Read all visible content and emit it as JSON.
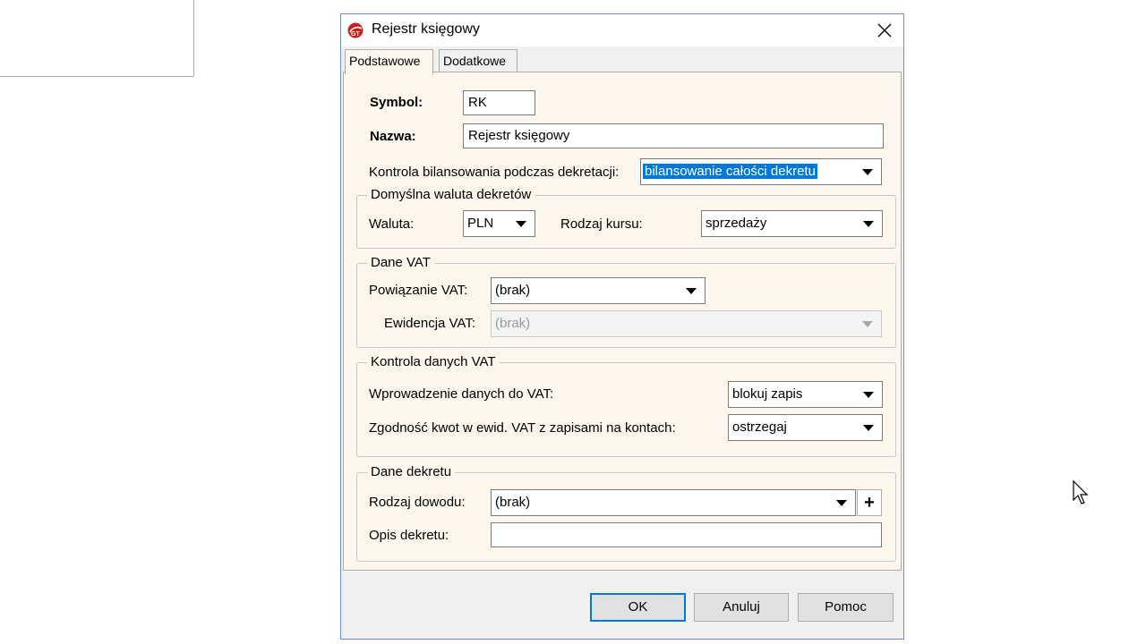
{
  "dialog": {
    "title": "Rejestr księgowy",
    "close_icon": "close-icon",
    "app_icon": "gt-logo-icon"
  },
  "tabs": [
    {
      "label": "Podstawowe",
      "active": true
    },
    {
      "label": "Dodatkowe",
      "active": false
    }
  ],
  "form": {
    "symbol_label": "Symbol:",
    "symbol_value": "RK",
    "name_label": "Nazwa:",
    "name_value": "Rejestr księgowy",
    "balance_label": "Kontrola bilansowania podczas dekretacji:",
    "balance_value": "bilansowanie całości dekretu"
  },
  "currency_group": {
    "legend": "Domyślna waluta dekretów",
    "currency_label": "Waluta:",
    "currency_value": "PLN",
    "rate_label": "Rodzaj kursu:",
    "rate_value": "sprzedaży"
  },
  "vat_group": {
    "legend": "Dane VAT",
    "link_label": "Powiązanie VAT:",
    "link_value": "(brak)",
    "register_label": "Ewidencja VAT:",
    "register_value": "(brak)"
  },
  "vat_control_group": {
    "legend": "Kontrola danych VAT",
    "entry_label": "Wprowadzenie danych do VAT:",
    "entry_value": "blokuj zapis",
    "match_label": "Zgodność kwot w ewid. VAT z zapisami na kontach:",
    "match_value": "ostrzegaj"
  },
  "decree_group": {
    "legend": "Dane dekretu",
    "doc_type_label": "Rodzaj dowodu:",
    "doc_type_value": "(brak)",
    "description_label": "Opis dekretu:",
    "description_value": ""
  },
  "buttons": {
    "ok": "OK",
    "cancel": "Anuluj",
    "help": "Pomoc"
  },
  "colors": {
    "accent": "#0078d7",
    "panel_bg": "#fdf6ec"
  }
}
